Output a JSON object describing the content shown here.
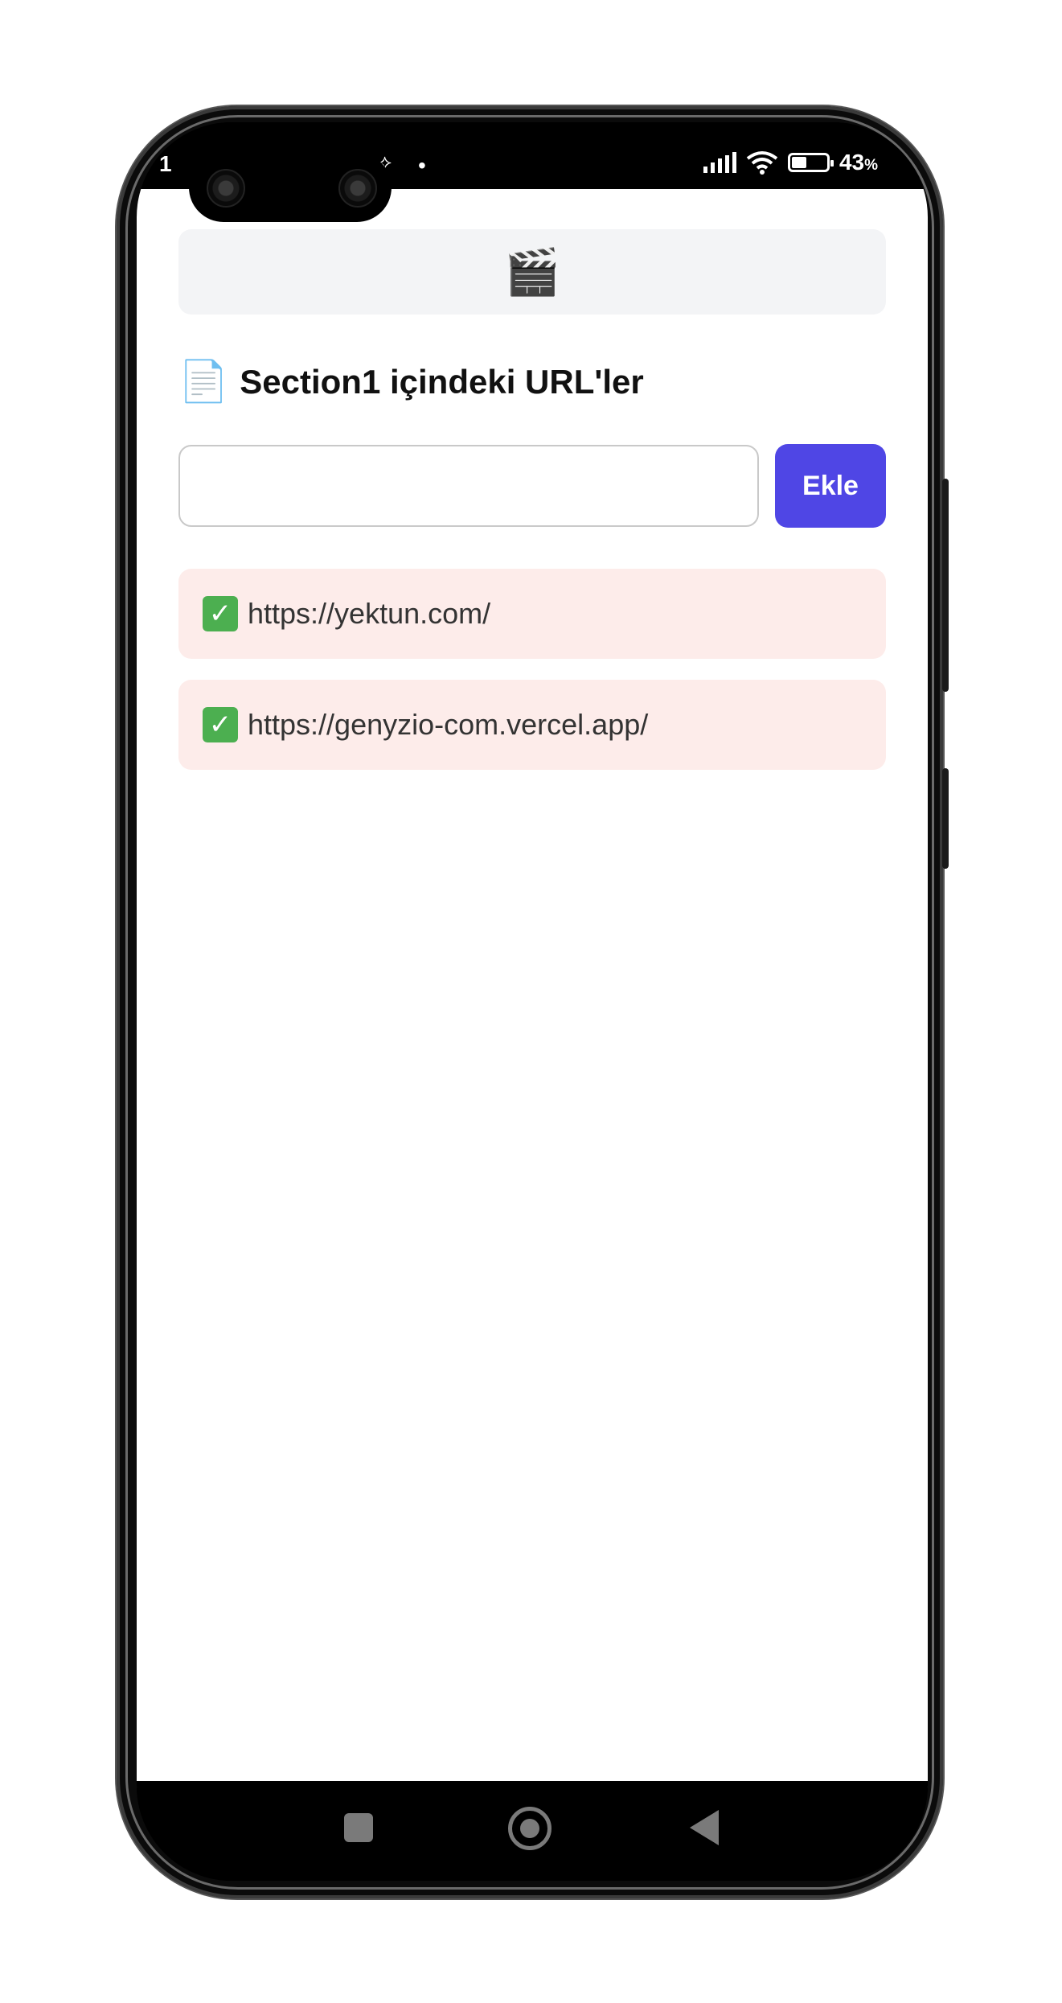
{
  "status_bar": {
    "time": "1",
    "notification": "⟡",
    "dot": "•",
    "battery_percent": "43",
    "battery_unit": "%",
    "battery_level": 0.43
  },
  "app": {
    "header_icon": "🎬",
    "section_icon": "📄",
    "section_title": "Section1 içindeki URL'ler",
    "url_input": {
      "value": "",
      "placeholder": ""
    },
    "add_button_label": "Ekle",
    "urls": [
      {
        "status_icon": "✓",
        "url": "https://yektun.com/"
      },
      {
        "status_icon": "✓",
        "url": "https://genyzio-com.vercel.app/"
      }
    ]
  },
  "colors": {
    "accent": "#4f46e5",
    "url_item_bg": "#fdecea",
    "header_bg": "#f3f4f6",
    "check": "#4caf50"
  },
  "nav_icons": [
    "recent-apps-icon",
    "home-icon",
    "back-icon"
  ]
}
